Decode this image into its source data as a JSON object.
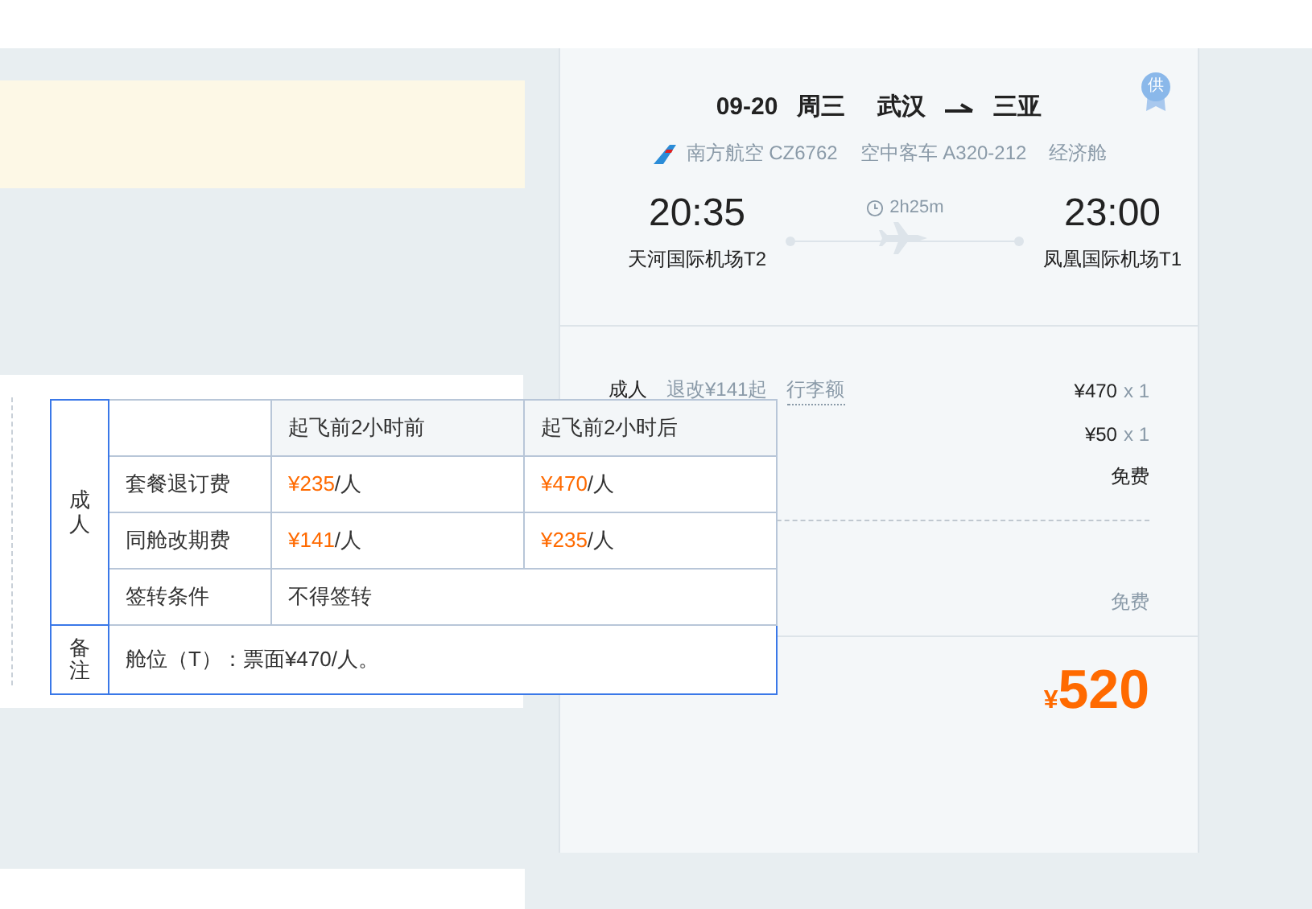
{
  "flight": {
    "date": "09-20",
    "weekday": "周三",
    "from": "武汉",
    "to": "三亚",
    "badge": "供",
    "airline": "南方航空 CZ6762",
    "aircraft": "空中客车 A320-212",
    "cabin": "经济舱",
    "dep_time": "20:35",
    "dep_airport": "天河国际机场T2",
    "duration": "2h25m",
    "arr_time": "23:00",
    "arr_airport": "凤凰国际机场T1"
  },
  "price_rows": [
    {
      "kind": "passenger",
      "label": "成人",
      "links": [
        "退改¥141起",
        "行李额"
      ],
      "price": "¥470",
      "qty": "x 1"
    },
    {
      "kind": "item",
      "price": "¥50",
      "qty": "x 1"
    },
    {
      "kind": "note",
      "text": "免费",
      "muted": false
    },
    {
      "kind": "separator"
    },
    {
      "kind": "note",
      "text": "免费",
      "muted": true
    }
  ],
  "total": {
    "currency": "¥",
    "amount": "520"
  },
  "rules_popup": {
    "header": [
      "起飞前2小时前",
      "起飞前2小时后"
    ],
    "group": "成人",
    "rows": [
      {
        "label": "套餐退订费",
        "cells": [
          {
            "amount": "¥235",
            "unit": "/人"
          },
          {
            "amount": "¥470",
            "unit": "/人"
          }
        ]
      },
      {
        "label": "同舱改期费",
        "cells": [
          {
            "amount": "¥141",
            "unit": "/人"
          },
          {
            "amount": "¥235",
            "unit": "/人"
          }
        ]
      }
    ],
    "condition": {
      "label": "签转条件",
      "value": "不得签转"
    },
    "note": {
      "label": "备注",
      "text": "舱位（T）：票面¥470/人。"
    }
  }
}
